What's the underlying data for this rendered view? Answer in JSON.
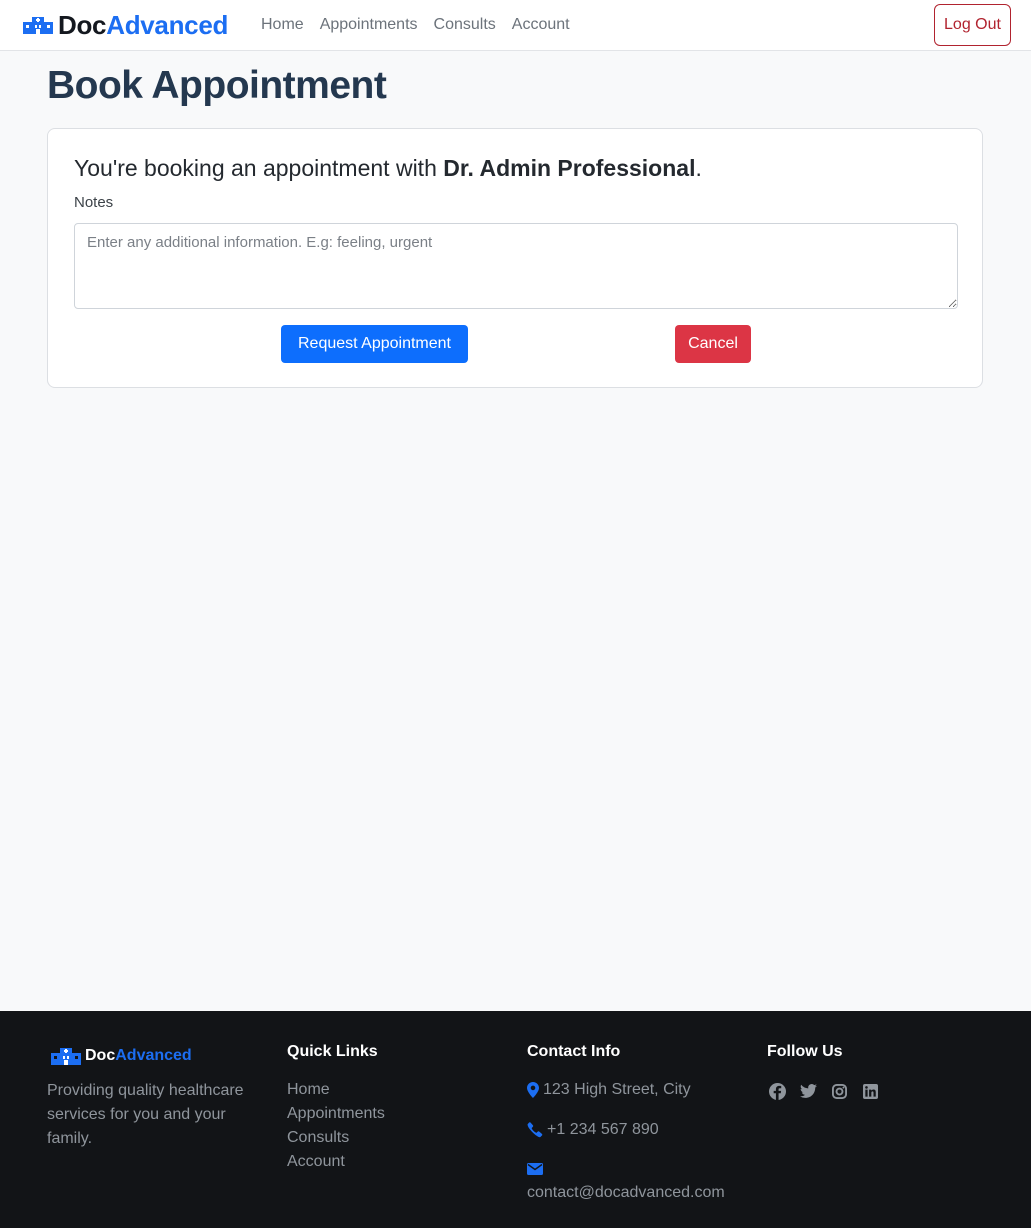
{
  "brand": {
    "part1": "Doc",
    "part2": "Advanced"
  },
  "nav": {
    "items": [
      {
        "label": "Home"
      },
      {
        "label": "Appointments"
      },
      {
        "label": "Consults"
      },
      {
        "label": "Account"
      }
    ],
    "logout_label": "Log Out"
  },
  "page": {
    "title": "Book Appointment"
  },
  "booking": {
    "prefix": "You're booking an appointment with ",
    "doctor": "Dr. Admin Professional",
    "suffix": ".",
    "notes_label": "Notes",
    "notes_placeholder": "Enter any additional information. E.g: feeling, urgent",
    "notes_value": "",
    "request_label": "Request Appointment",
    "cancel_label": "Cancel"
  },
  "footer": {
    "about": "Providing quality healthcare services for you and your family.",
    "quick_links_heading": "Quick Links",
    "quick_links": [
      "Home",
      "Appointments",
      "Consults",
      "Account"
    ],
    "contact_heading": "Contact Info",
    "address": "123 High Street, City",
    "phone": "+1 234 567 890",
    "email": "contact@docadvanced.com",
    "follow_heading": "Follow Us",
    "social_icons": [
      "facebook-icon",
      "twitter-icon",
      "instagram-icon",
      "linkedin-icon"
    ]
  },
  "colors": {
    "primary": "#0d6efd",
    "danger": "#dc3545",
    "brand_blue": "#1c6ef2",
    "footer_bg": "#121417",
    "title": "#24384f"
  }
}
